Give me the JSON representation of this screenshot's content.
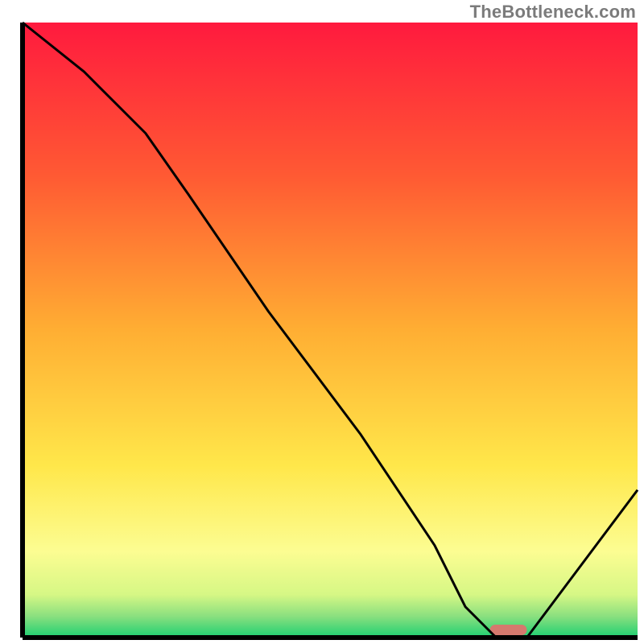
{
  "watermark": "TheBottleneck.com",
  "chart_data": {
    "type": "line",
    "title": "",
    "xlabel": "",
    "ylabel": "",
    "xlim": [
      0,
      100
    ],
    "ylim": [
      0,
      100
    ],
    "x": [
      0,
      10,
      20,
      27,
      40,
      55,
      67,
      72,
      77,
      82,
      100
    ],
    "values": [
      100,
      92,
      82,
      72,
      53,
      33,
      15,
      5,
      0,
      0,
      24
    ],
    "minimum_marker": {
      "x_start": 76,
      "x_end": 82,
      "color": "#d5796e"
    },
    "gradient_stops": [
      {
        "offset": 0.0,
        "color": "#ff1a3e"
      },
      {
        "offset": 0.25,
        "color": "#ff5a33"
      },
      {
        "offset": 0.5,
        "color": "#ffae33"
      },
      {
        "offset": 0.72,
        "color": "#ffe74a"
      },
      {
        "offset": 0.86,
        "color": "#fcfd92"
      },
      {
        "offset": 0.93,
        "color": "#d6f785"
      },
      {
        "offset": 0.965,
        "color": "#8be07f"
      },
      {
        "offset": 1.0,
        "color": "#1dcf72"
      }
    ],
    "axis_color": "#000000",
    "curve_color": "#000000"
  }
}
